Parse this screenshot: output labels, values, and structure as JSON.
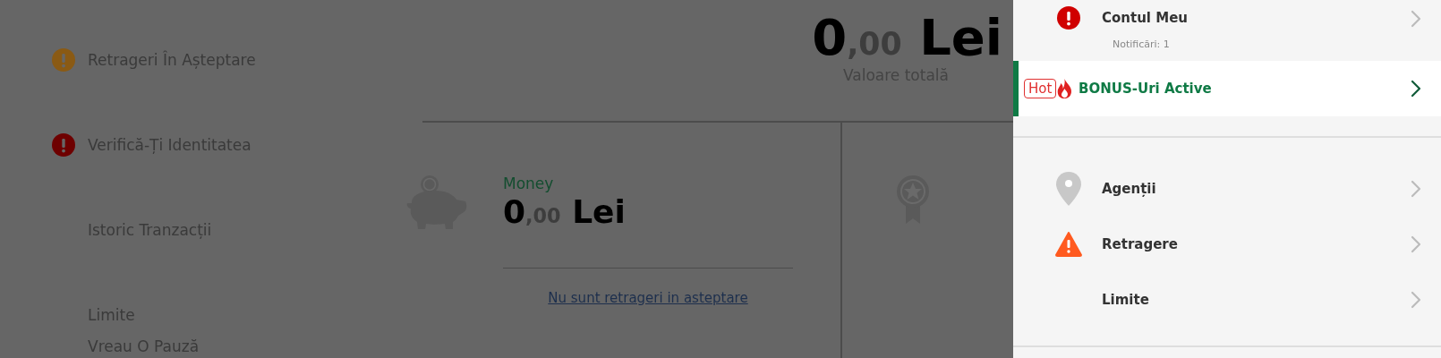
{
  "sidebar": {
    "groups": [
      [
        {
          "label": "Retrageri În Așteptare",
          "kind": "warning"
        }
      ],
      [
        {
          "label": "Verifică-Ți Identitatea",
          "kind": "alert"
        }
      ],
      [
        {
          "label": "Istoric Tranzacții",
          "kind": "plain"
        }
      ],
      [
        {
          "label": "Limite",
          "kind": "plain"
        },
        {
          "label": "Vreau O Pauză",
          "kind": "plain"
        }
      ]
    ]
  },
  "total": {
    "whole": "0",
    "decimals": ",00",
    "currency": "Lei",
    "caption": "Valoare totală"
  },
  "wallets": [
    {
      "kind": "money",
      "title": "Money",
      "whole": "0",
      "decimals": ",00",
      "currency": "Lei",
      "link": "Nu sunt retrageri in asteptare"
    },
    {
      "kind": "medal"
    }
  ],
  "menu": {
    "groups": [
      [
        {
          "label": "Contul Meu",
          "kind": "alert",
          "note": "Notificări: 1",
          "selected": false
        },
        {
          "label": "BONUS-Uri Active",
          "kind": "hot",
          "badge": "Hot",
          "selected": true
        }
      ],
      [
        {
          "label": "Agenții",
          "kind": "pin",
          "selected": false
        },
        {
          "label": "Retragere",
          "kind": "warning",
          "selected": false
        },
        {
          "label": "Limite",
          "kind": "plain",
          "selected": false
        }
      ]
    ]
  }
}
